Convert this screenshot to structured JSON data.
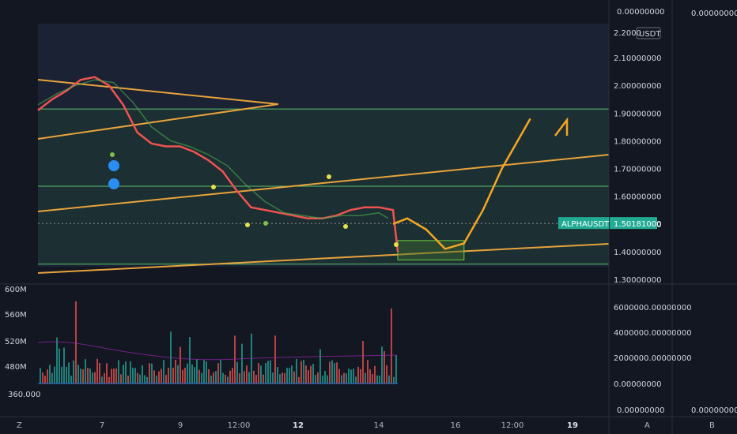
{
  "chart_data": [
    {
      "type": "line",
      "title": "",
      "symbol": "ALPHAUSDT",
      "currency": "USDT",
      "last_price": "1.50181000",
      "price_top_label": "2.2000",
      "price_ticks": [
        "2.10000000",
        "2.00000000",
        "1.90000000",
        "1.80000000",
        "1.70000000",
        "1.60000000",
        "1.50000000",
        "1.40000000",
        "1.30000000"
      ],
      "price_tick_values": [
        2.1,
        2.0,
        1.9,
        1.8,
        1.7,
        1.6,
        1.5,
        1.4,
        1.3
      ],
      "ylim": [
        1.3,
        2.2
      ],
      "x_labels": [
        "7",
        "9",
        "12:00",
        "12",
        "14",
        "16",
        "12:00",
        "19"
      ],
      "x_labels_bold": [
        "12",
        "19"
      ],
      "scale_zero_labels": [
        "0.00000000",
        "0.00000000",
        "0.00000000",
        "0.00000000"
      ],
      "corner_labels": [
        "Z",
        "A",
        "B"
      ],
      "price_series": {
        "name": "",
        "x": [
          0,
          0.3,
          0.6,
          0.9,
          1.2,
          1.5,
          1.8,
          2.1,
          2.4,
          2.7,
          3.0,
          3.3,
          3.6,
          3.9,
          4.2,
          4.5,
          4.8,
          5.1,
          5.4,
          5.7,
          6.0,
          6.3,
          6.6,
          6.9,
          7.2,
          7.5,
          7.6
        ],
        "y": [
          1.91,
          1.95,
          1.98,
          2.02,
          2.03,
          2.0,
          1.93,
          1.83,
          1.79,
          1.78,
          1.78,
          1.76,
          1.73,
          1.69,
          1.62,
          1.56,
          1.55,
          1.54,
          1.53,
          1.52,
          1.52,
          1.53,
          1.55,
          1.56,
          1.56,
          1.55,
          1.4
        ],
        "color": "#ef5350"
      },
      "moving_average": {
        "x": [
          0,
          0.4,
          0.8,
          1.2,
          1.6,
          2.0,
          2.4,
          2.8,
          3.2,
          3.6,
          4.0,
          4.4,
          4.8,
          5.2,
          5.6,
          6.0,
          6.4,
          6.8,
          7.2,
          7.4
        ],
        "y": [
          1.93,
          1.97,
          2.0,
          2.02,
          2.01,
          1.94,
          1.85,
          1.8,
          1.78,
          1.75,
          1.71,
          1.64,
          1.58,
          1.54,
          1.53,
          1.52,
          1.53,
          1.53,
          1.54,
          1.52
        ],
        "color": "#f0655c"
      },
      "zones": {
        "lines": [
          1.915,
          1.636,
          1.355
        ],
        "band_color": "#21463a"
      },
      "annotation_box": {
        "x_range": [
          7.6,
          9.0
        ],
        "y_range": [
          1.37,
          1.44
        ]
      },
      "projection": {
        "x": [
          7.5,
          7.8,
          8.2,
          8.6,
          9.0,
          9.4,
          9.8,
          10.2,
          10.4
        ],
        "y": [
          1.5,
          1.52,
          1.48,
          1.41,
          1.43,
          1.55,
          1.7,
          1.82,
          1.88
        ],
        "color": "#f5a623"
      },
      "volume": {
        "ticks": [
          "600M",
          "560M",
          "520M",
          "480M"
        ],
        "right_ticks": [
          "6000000.00000000",
          "4000000.00000000",
          "2000000.00000000",
          "0.00000000"
        ],
        "bottom_label": "360.000"
      }
    }
  ]
}
